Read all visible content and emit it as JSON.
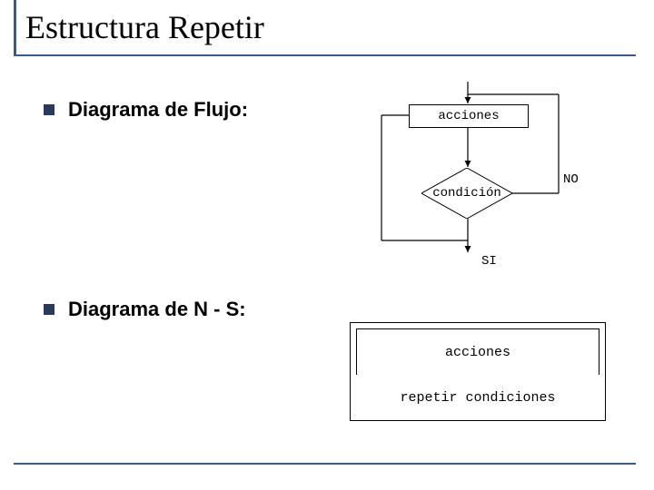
{
  "title": "Estructura Repetir",
  "bullets": {
    "flujo": "Diagrama de Flujo:",
    "ns": "Diagrama de N - S:"
  },
  "flowchart": {
    "acciones": "acciones",
    "condicion": "condición",
    "si": "SI",
    "no": "NO"
  },
  "ns_diagram": {
    "acciones": "acciones",
    "repetir": "repetir condiciones"
  }
}
